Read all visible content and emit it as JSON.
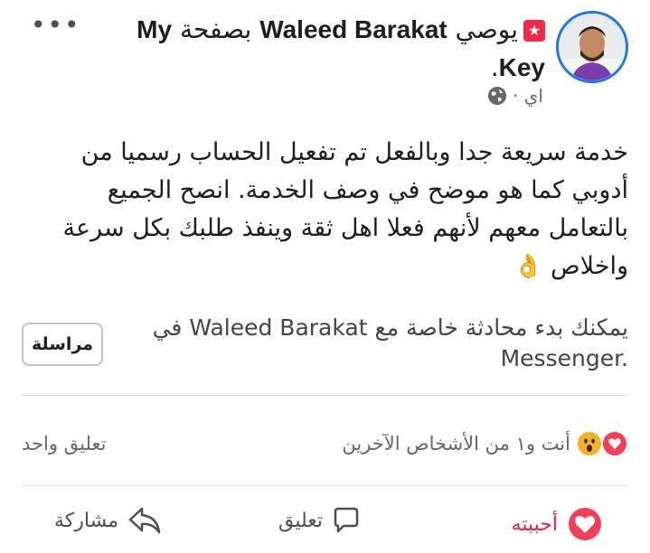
{
  "header": {
    "recommends": "يوصي",
    "user_name": "Waleed Barakat",
    "page_prefix": "بصفحة",
    "page_name_part1": "My",
    "page_name_part2": "Key",
    "period": ".",
    "time_ago": "اي ·",
    "more_label": "•••",
    "globe_icon": "globe-icon"
  },
  "post": {
    "text": "خدمة سريعة جدا وبالفعل تم تفعيل الحساب رسميا من أدوبي كما هو موضح في وصف الخدمة. انصح الجميع بالتعامل معهم لأنهم فعلا اهل ثقة وينفذ طلبك بكل سرعة واخلاص",
    "emoji": "👌"
  },
  "messenger": {
    "prompt_prefix": "يمكنك بدء محادثة خاصة مع",
    "name": "Waleed Barakat",
    "prompt_in": "في",
    "app": "Messenger.",
    "button_label": "مراسلة"
  },
  "stats": {
    "reactions_text": "أنت و١ من الأشخاص الآخرين",
    "comments_text": "تعليق واحد",
    "reaction_icons": [
      "love-icon",
      "wow-icon"
    ]
  },
  "actions": {
    "like_label": "أحببته",
    "comment_label": "تعليق",
    "share_label": "مشاركة"
  },
  "colors": {
    "love": "#f33e58",
    "liked_text": "#e4264b",
    "avatar_ring": "#1877f2",
    "wow": "#f7b125"
  }
}
